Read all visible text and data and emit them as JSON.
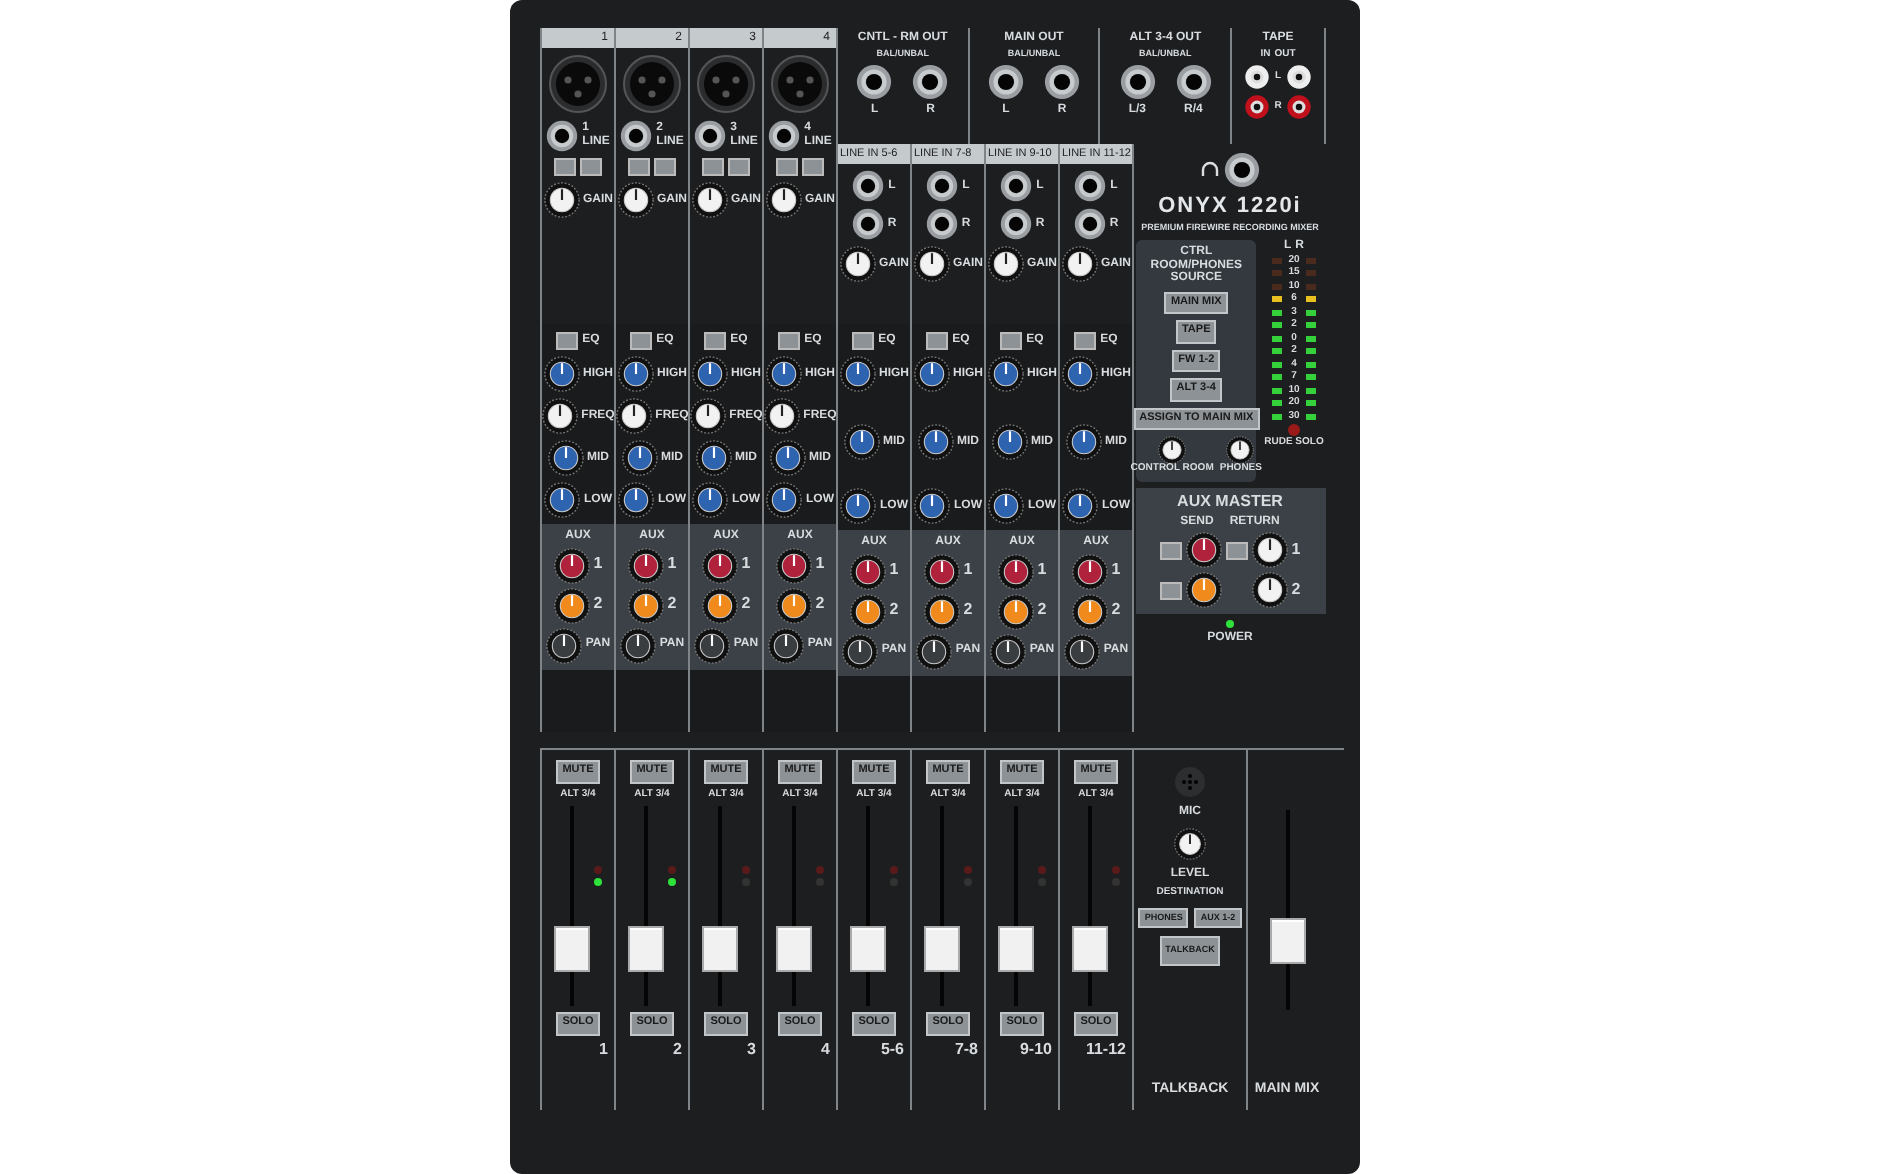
{
  "outputs": [
    {
      "title": "CNTL - RM OUT",
      "sub": "BAL/UNBAL",
      "jacks": [
        "L",
        "R"
      ]
    },
    {
      "title": "MAIN OUT",
      "sub": "BAL/UNBAL",
      "jacks": [
        "L",
        "R"
      ]
    },
    {
      "title": "ALT 3-4 OUT",
      "sub": "BAL/UNBAL",
      "jacks": [
        "L/3",
        "R/4"
      ]
    }
  ],
  "tape": {
    "title": "TAPE",
    "in": "IN",
    "out": "OUT",
    "l": "L",
    "r": "R"
  },
  "channels": [
    {
      "kind": "mono",
      "tab": "1",
      "num": "1",
      "line": "LINE",
      "gain": "GAIN",
      "eq": "EQ",
      "high": "HIGH",
      "mid": "MID",
      "freq": "FREQ",
      "low": "LOW",
      "aux": "AUX",
      "aux1": "1",
      "aux2": "2",
      "pan": "PAN"
    },
    {
      "kind": "mono",
      "tab": "2",
      "num": "2",
      "line": "LINE",
      "gain": "GAIN",
      "eq": "EQ",
      "high": "HIGH",
      "mid": "MID",
      "freq": "FREQ",
      "low": "LOW",
      "aux": "AUX",
      "aux1": "1",
      "aux2": "2",
      "pan": "PAN"
    },
    {
      "kind": "mono",
      "tab": "3",
      "num": "3",
      "line": "LINE",
      "gain": "GAIN",
      "eq": "EQ",
      "high": "HIGH",
      "mid": "MID",
      "freq": "FREQ",
      "low": "LOW",
      "aux": "AUX",
      "aux1": "1",
      "aux2": "2",
      "pan": "PAN"
    },
    {
      "kind": "mono",
      "tab": "4",
      "num": "4",
      "line": "LINE",
      "gain": "GAIN",
      "eq": "EQ",
      "high": "HIGH",
      "mid": "MID",
      "freq": "FREQ",
      "low": "LOW",
      "aux": "AUX",
      "aux1": "1",
      "aux2": "2",
      "pan": "PAN"
    },
    {
      "kind": "stereo",
      "tab": "LINE IN 5-6",
      "l": "L",
      "r": "R",
      "gain": "GAIN",
      "eq": "EQ",
      "high": "HIGH",
      "mid": "MID",
      "low": "LOW",
      "aux": "AUX",
      "aux1": "1",
      "aux2": "2",
      "pan": "PAN"
    },
    {
      "kind": "stereo",
      "tab": "LINE IN 7-8",
      "l": "L",
      "r": "R",
      "gain": "GAIN",
      "eq": "EQ",
      "high": "HIGH",
      "mid": "MID",
      "low": "LOW",
      "aux": "AUX",
      "aux1": "1",
      "aux2": "2",
      "pan": "PAN"
    },
    {
      "kind": "stereo",
      "tab": "LINE IN 9-10",
      "l": "L",
      "r": "R",
      "gain": "GAIN",
      "eq": "EQ",
      "high": "HIGH",
      "mid": "MID",
      "low": "LOW",
      "aux": "AUX",
      "aux1": "1",
      "aux2": "2",
      "pan": "PAN"
    },
    {
      "kind": "stereo",
      "tab": "LINE IN 11-12",
      "l": "L",
      "r": "R",
      "gain": "GAIN",
      "eq": "EQ",
      "high": "HIGH",
      "mid": "MID",
      "low": "LOW",
      "aux": "AUX",
      "aux1": "1",
      "aux2": "2",
      "pan": "PAN"
    }
  ],
  "brand": {
    "name": "ONYX 1220i",
    "tagline": "PREMIUM FIREWIRE RECORDING MIXER"
  },
  "source": {
    "title": "CTRL ROOM/PHONES SOURCE",
    "buttons": [
      "MAIN MIX",
      "TAPE",
      "FW 1-2",
      "ALT 3-4"
    ],
    "assign": "ASSIGN TO MAIN MIX",
    "knobs": [
      "CONTROL ROOM",
      "PHONES"
    ]
  },
  "meter": {
    "l": "L",
    "r": "R",
    "marks": [
      "20",
      "15",
      "10",
      "6",
      "3",
      "2",
      "0",
      "2",
      "4",
      "7",
      "10",
      "20",
      "30"
    ],
    "solo": "RUDE SOLO"
  },
  "aux_master": {
    "title": "AUX MASTER",
    "send": "SEND",
    "return": "RETURN",
    "n1": "1",
    "n2": "2"
  },
  "power": "POWER",
  "faders": [
    {
      "mute": "MUTE",
      "alt": "ALT 3/4",
      "solo": "SOLO",
      "label": "1",
      "level": 0.22,
      "signal": true
    },
    {
      "mute": "MUTE",
      "alt": "ALT 3/4",
      "solo": "SOLO",
      "label": "2",
      "level": 0.22,
      "signal": true
    },
    {
      "mute": "MUTE",
      "alt": "ALT 3/4",
      "solo": "SOLO",
      "label": "3",
      "level": 0.22,
      "signal": false
    },
    {
      "mute": "MUTE",
      "alt": "ALT 3/4",
      "solo": "SOLO",
      "label": "4",
      "level": 0.22,
      "signal": false
    },
    {
      "mute": "MUTE",
      "alt": "ALT 3/4",
      "solo": "SOLO",
      "label": "5-6",
      "level": 0.22,
      "signal": false
    },
    {
      "mute": "MUTE",
      "alt": "ALT 3/4",
      "solo": "SOLO",
      "label": "7-8",
      "level": 0.22,
      "signal": false
    },
    {
      "mute": "MUTE",
      "alt": "ALT 3/4",
      "solo": "SOLO",
      "label": "9-10",
      "level": 0.22,
      "signal": false
    },
    {
      "mute": "MUTE",
      "alt": "ALT 3/4",
      "solo": "SOLO",
      "label": "11-12",
      "level": 0.22,
      "signal": false
    }
  ],
  "talkback": {
    "mic": "MIC",
    "level": "LEVEL",
    "destination": "DESTINATION",
    "buttons": [
      "PHONES",
      "AUX 1-2"
    ],
    "button": "TALKBACK",
    "label": "TALKBACK"
  },
  "main_mix": {
    "label": "MAIN MIX",
    "level": 0.3
  }
}
